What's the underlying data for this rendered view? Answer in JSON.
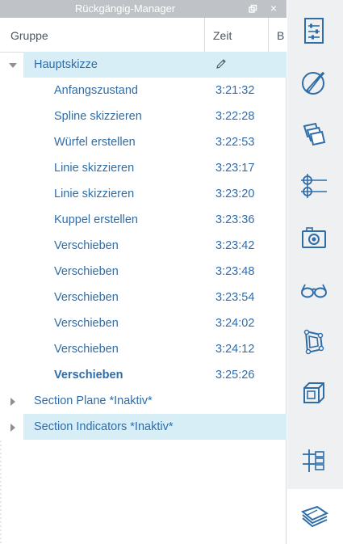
{
  "window": {
    "title": "Rückgängig-Manager",
    "close_label": "×"
  },
  "columns": {
    "group": "Gruppe",
    "time": "Zeit",
    "third": "B"
  },
  "groups": [
    {
      "name": "Hauptskizze",
      "expanded": true,
      "entries": [
        {
          "label": "Anfangszustand",
          "time": "3:21:32"
        },
        {
          "label": "Spline skizzieren",
          "time": "3:22:28"
        },
        {
          "label": "Würfel erstellen",
          "time": "3:22:53"
        },
        {
          "label": "Linie skizzieren",
          "time": "3:23:17"
        },
        {
          "label": "Linie skizzieren",
          "time": "3:23:20"
        },
        {
          "label": "Kuppel erstellen",
          "time": "3:23:36"
        },
        {
          "label": "Verschieben",
          "time": "3:23:42"
        },
        {
          "label": "Verschieben",
          "time": "3:23:48"
        },
        {
          "label": "Verschieben",
          "time": "3:23:54"
        },
        {
          "label": "Verschieben",
          "time": "3:24:02"
        },
        {
          "label": "Verschieben",
          "time": "3:24:12"
        },
        {
          "label": "Verschieben",
          "time": "3:25:26",
          "current": true
        }
      ]
    },
    {
      "name": "Section Plane *Inaktiv*",
      "expanded": false
    },
    {
      "name": "Section Indicators *Inaktiv*",
      "expanded": false
    }
  ],
  "iconbar": [
    {
      "icon": "settings-panel-icon"
    },
    {
      "icon": "paint-brush-icon"
    },
    {
      "icon": "layers-stack-icon"
    },
    {
      "icon": "guides-icon"
    },
    {
      "icon": "camera-icon"
    },
    {
      "icon": "glasses-icon"
    },
    {
      "icon": "components-icon"
    },
    {
      "icon": "section-box-icon"
    },
    {
      "icon": "outliner-icon"
    },
    {
      "icon": "undo-manager-icon"
    }
  ],
  "colors": {
    "accent_text": "#2f6da8",
    "selection": "#d8eef7",
    "titlebar": "#bfc3c7",
    "icon": "#2f6da8"
  }
}
